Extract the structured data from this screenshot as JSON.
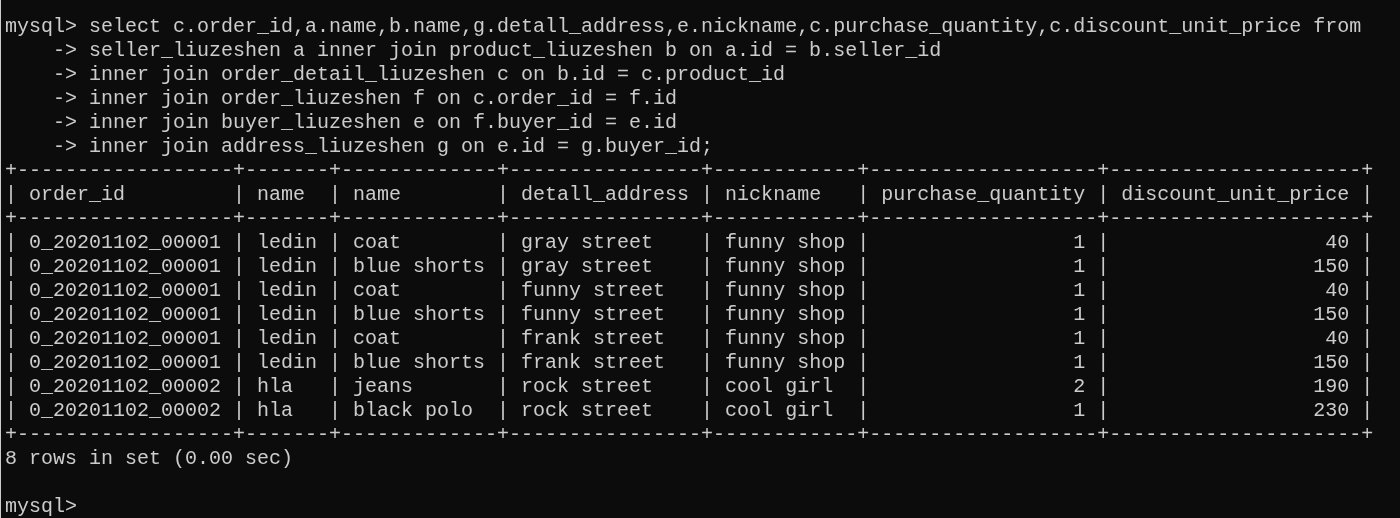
{
  "terminal": {
    "lines": [
      {
        "kind": "command",
        "text": "mysql> select c.order_id,a.name,b.name,g.detall_address,e.nickname,c.purchase_quantity,c.discount_unit_price from"
      },
      {
        "kind": "continuation",
        "text": "-> seller_liuzeshen a inner join product_liuzeshen b on a.id = b.seller_id"
      },
      {
        "kind": "continuation",
        "text": "-> inner join order_detail_liuzeshen c on b.id = c.product_id"
      },
      {
        "kind": "continuation",
        "text": "-> inner join order_liuzeshen f on c.order_id = f.id"
      },
      {
        "kind": "continuation",
        "text": "-> inner join buyer_liuzeshen e on f.buyer_id = e.id"
      },
      {
        "kind": "continuation",
        "text": "-> inner join address_liuzeshen g on e.id = g.buyer_id;"
      },
      {
        "kind": "border",
        "text": "+------------------+-------+-------------+----------------+------------+-------------------+---------------------+"
      },
      {
        "kind": "header",
        "text": "| order_id         | name  | name        | detall_address | nickname   | purchase_quantity | discount_unit_price |"
      },
      {
        "kind": "border",
        "text": "+------------------+-------+-------------+----------------+------------+-------------------+---------------------+"
      },
      {
        "kind": "row",
        "text": "| 0_20201102_00001 | ledin | coat        | gray street    | funny shop |                 1 |                  40 |"
      },
      {
        "kind": "row",
        "text": "| 0_20201102_00001 | ledin | blue shorts | gray street    | funny shop |                 1 |                 150 |"
      },
      {
        "kind": "row",
        "text": "| 0_20201102_00001 | ledin | coat        | funny street   | funny shop |                 1 |                  40 |"
      },
      {
        "kind": "row",
        "text": "| 0_20201102_00001 | ledin | blue shorts | funny street   | funny shop |                 1 |                 150 |"
      },
      {
        "kind": "row",
        "text": "| 0_20201102_00001 | ledin | coat        | frank street   | funny shop |                 1 |                  40 |"
      },
      {
        "kind": "row",
        "text": "| 0_20201102_00001 | ledin | blue shorts | frank street   | funny shop |                 1 |                 150 |"
      },
      {
        "kind": "row",
        "text": "| 0_20201102_00002 | hla   | jeans       | rock street    | cool girl  |                 2 |                 190 |"
      },
      {
        "kind": "row",
        "text": "| 0_20201102_00002 | hla   | black polo  | rock street    | cool girl  |                 1 |                 230 |"
      },
      {
        "kind": "border",
        "text": "+------------------+-------+-------------+----------------+------------+-------------------+---------------------+"
      },
      {
        "kind": "summary",
        "text": "8 rows in set (0.00 sec)"
      },
      {
        "kind": "prompt",
        "text": "mysql>"
      }
    ]
  }
}
